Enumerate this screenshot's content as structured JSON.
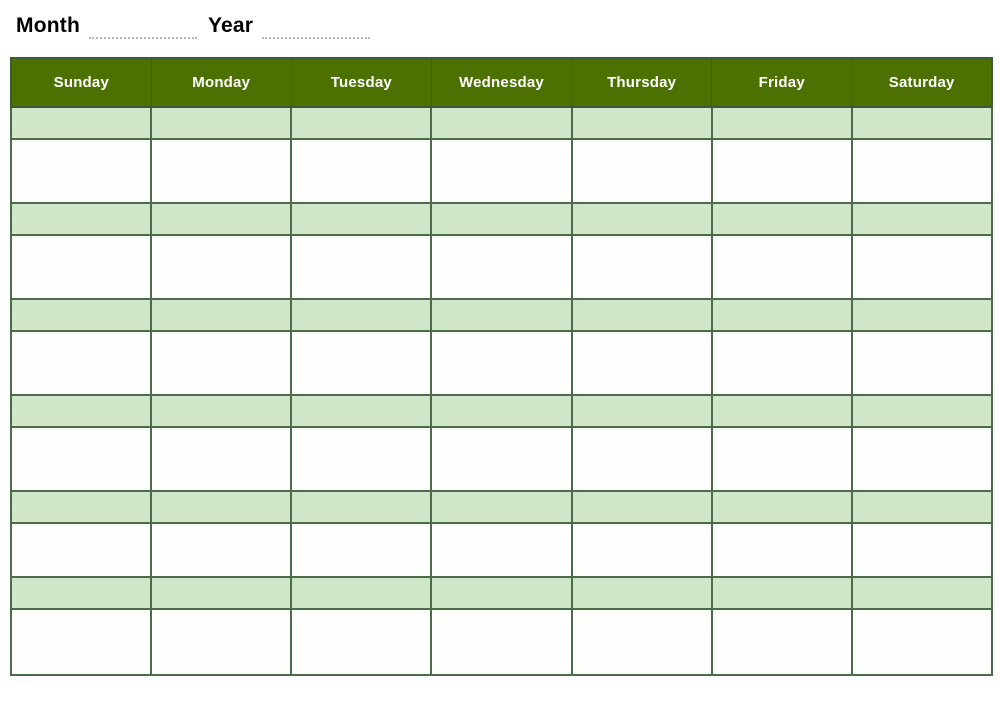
{
  "document": {
    "type": "blank-monthly-calendar-template"
  },
  "header": {
    "month_label": "Month",
    "year_label": "Year",
    "month_value": "",
    "year_value": "",
    "month_placeholder": "",
    "year_placeholder": ""
  },
  "calendar": {
    "day_headers": [
      "Sunday",
      "Monday",
      "Tuesday",
      "Wednesday",
      "Thursday",
      "Friday",
      "Saturday"
    ],
    "week_count": 6,
    "rows": [
      {
        "date_cells": [
          "",
          "",
          "",
          "",
          "",
          "",
          ""
        ],
        "note_cells": [
          "",
          "",
          "",
          "",
          "",
          "",
          ""
        ]
      },
      {
        "date_cells": [
          "",
          "",
          "",
          "",
          "",
          "",
          ""
        ],
        "note_cells": [
          "",
          "",
          "",
          "",
          "",
          "",
          ""
        ]
      },
      {
        "date_cells": [
          "",
          "",
          "",
          "",
          "",
          "",
          ""
        ],
        "note_cells": [
          "",
          "",
          "",
          "",
          "",
          "",
          ""
        ]
      },
      {
        "date_cells": [
          "",
          "",
          "",
          "",
          "",
          "",
          ""
        ],
        "note_cells": [
          "",
          "",
          "",
          "",
          "",
          "",
          ""
        ]
      },
      {
        "date_cells": [
          "",
          "",
          "",
          "",
          "",
          "",
          ""
        ],
        "note_cells": [
          "",
          "",
          "",
          "",
          "",
          "",
          ""
        ]
      },
      {
        "date_cells": [
          "",
          "",
          "",
          "",
          "",
          "",
          ""
        ],
        "note_cells": [
          "",
          "",
          "",
          "",
          "",
          "",
          ""
        ]
      }
    ]
  },
  "colors": {
    "header_green": "#4d7101",
    "date_row_green": "#cfe6c8",
    "note_row_white": "#fdfffc",
    "border_green": "#4b6b4b",
    "dotted_line_gray": "#b9b9b9",
    "title_text": "#000000",
    "header_text": "#ffffff"
  }
}
